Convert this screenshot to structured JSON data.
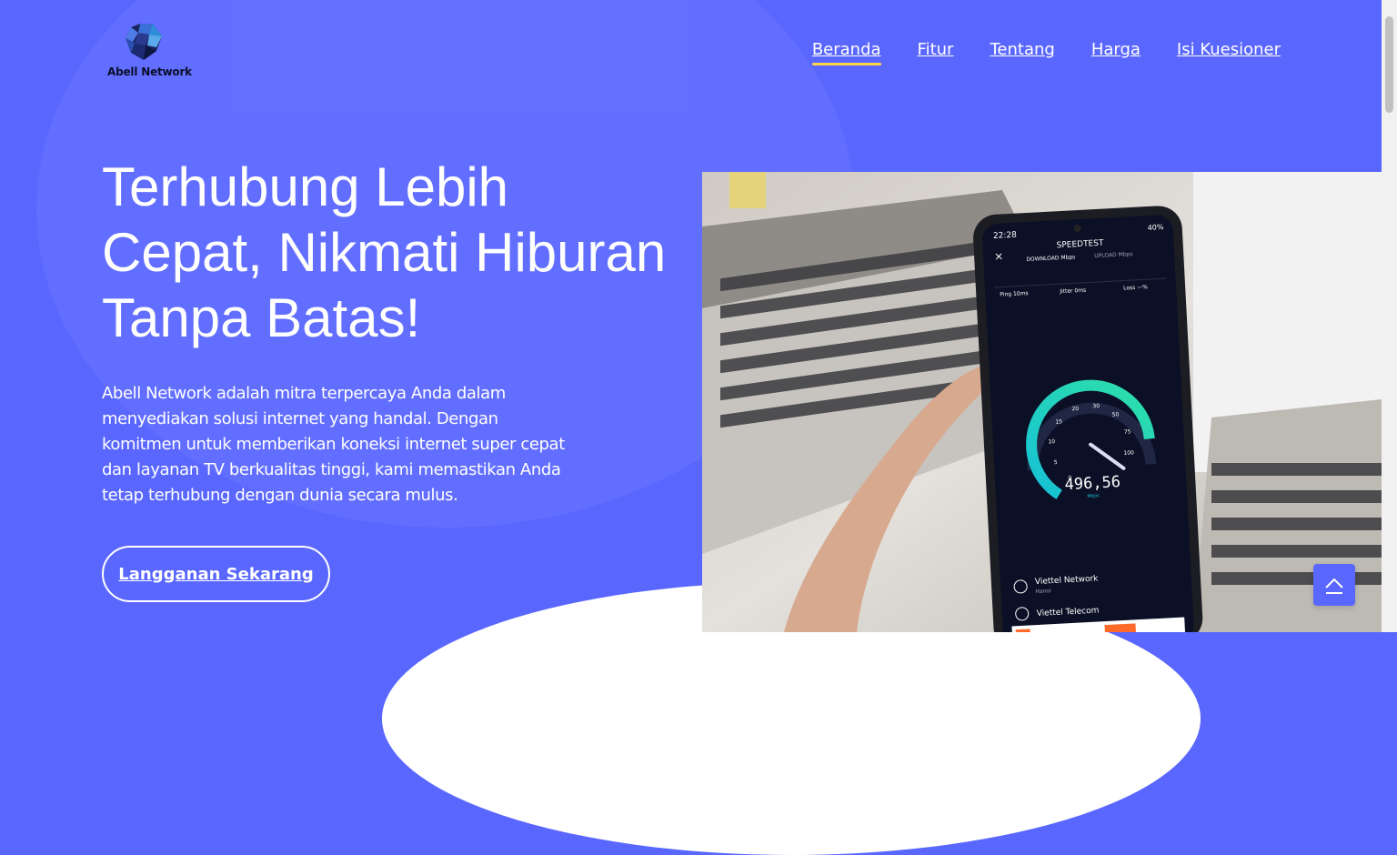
{
  "brand": {
    "name": "Abell Network",
    "logo_icon": "hexagon-globe-logo",
    "colors": {
      "primary": "#5a67ff",
      "accent": "#ffd54a",
      "text": "#ffffff"
    }
  },
  "nav": {
    "items": [
      {
        "label": "Beranda",
        "active": true
      },
      {
        "label": "Fitur"
      },
      {
        "label": "Tentang"
      },
      {
        "label": "Harga"
      },
      {
        "label": "Isi Kuesioner"
      }
    ]
  },
  "hero": {
    "title_lines": [
      "Terhubung Lebih",
      "Cepat, Nikmati Hiburan",
      "Tanpa Batas!"
    ],
    "description": "Abell Network adalah mitra terpercaya Anda dalam menyediakan solusi internet yang handal. Dengan komitmen untuk memberikan koneksi internet super cepat dan layanan TV berkualitas tinggi, kami memastikan Anda tetap terhubung dengan dunia secara mulus.",
    "cta_label": "Langganan Sekarang"
  },
  "speedtest_photo": {
    "status_time": "22:28",
    "battery": "40%",
    "app_title": "SPEEDTEST",
    "download_label": "DOWNLOAD Mbps",
    "upload_label": "UPLOAD Mbps",
    "ping": "Ping 10ms",
    "jitter": "Jitter 0ms",
    "loss": "Loss —%",
    "gauge_ticks": [
      "0",
      "5",
      "10",
      "15",
      "20",
      "30",
      "50",
      "75",
      "100"
    ],
    "speed_value": "496,56",
    "speed_unit": "Mbps",
    "provider_name": "Viettel Network",
    "provider_city": "Hanoi",
    "server_name": "Viettel Telecom",
    "gauge_level_fraction": 0.93
  },
  "back_to_top_icon": "chevron-up-icon"
}
